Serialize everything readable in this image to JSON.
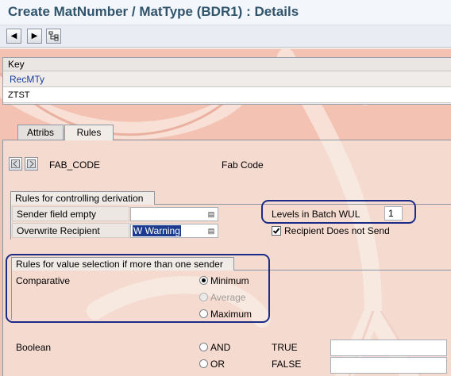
{
  "window": {
    "title": "Create MatNumber / MatType (BDR1) : Details"
  },
  "toolbar": {
    "back_icon": "triangle-left-icon",
    "forward_icon": "triangle-right-icon",
    "other_icon": "hierarchy-icon"
  },
  "key": {
    "header": "Key",
    "column": "RecMTy",
    "value": "ZTST"
  },
  "tabs": [
    {
      "label": "Attribs",
      "active": false
    },
    {
      "label": "Rules",
      "active": true
    }
  ],
  "field": {
    "code": "FAB_CODE",
    "description": "Fab Code"
  },
  "rules_derivation": {
    "title": "Rules for controlling derivation",
    "sender_empty_label": "Sender field empty",
    "sender_empty_value": "",
    "overwrite_label": "Overwrite Recipient",
    "overwrite_value": "W Warning",
    "levels_label": "Levels in Batch WUL",
    "levels_value": "1",
    "recipient_no_send_label": "Recipient Does not Send",
    "recipient_no_send_checked": true
  },
  "rules_selection": {
    "title": "Rules for value selection if more than one sender",
    "comparative_label": "Comparative",
    "options": [
      {
        "label": "Minimum",
        "selected": true,
        "disabled": false
      },
      {
        "label": "Average",
        "selected": false,
        "disabled": true
      },
      {
        "label": "Maximum",
        "selected": false,
        "disabled": false
      }
    ]
  },
  "boolean": {
    "label": "Boolean",
    "and_label": "AND",
    "or_label": "OR",
    "true_label": "TRUE",
    "false_label": "FALSE",
    "true_value": "",
    "false_value": ""
  },
  "colors": {
    "highlight": "#1b2c86",
    "title": "#30546c",
    "background": "#f4c2b2"
  }
}
